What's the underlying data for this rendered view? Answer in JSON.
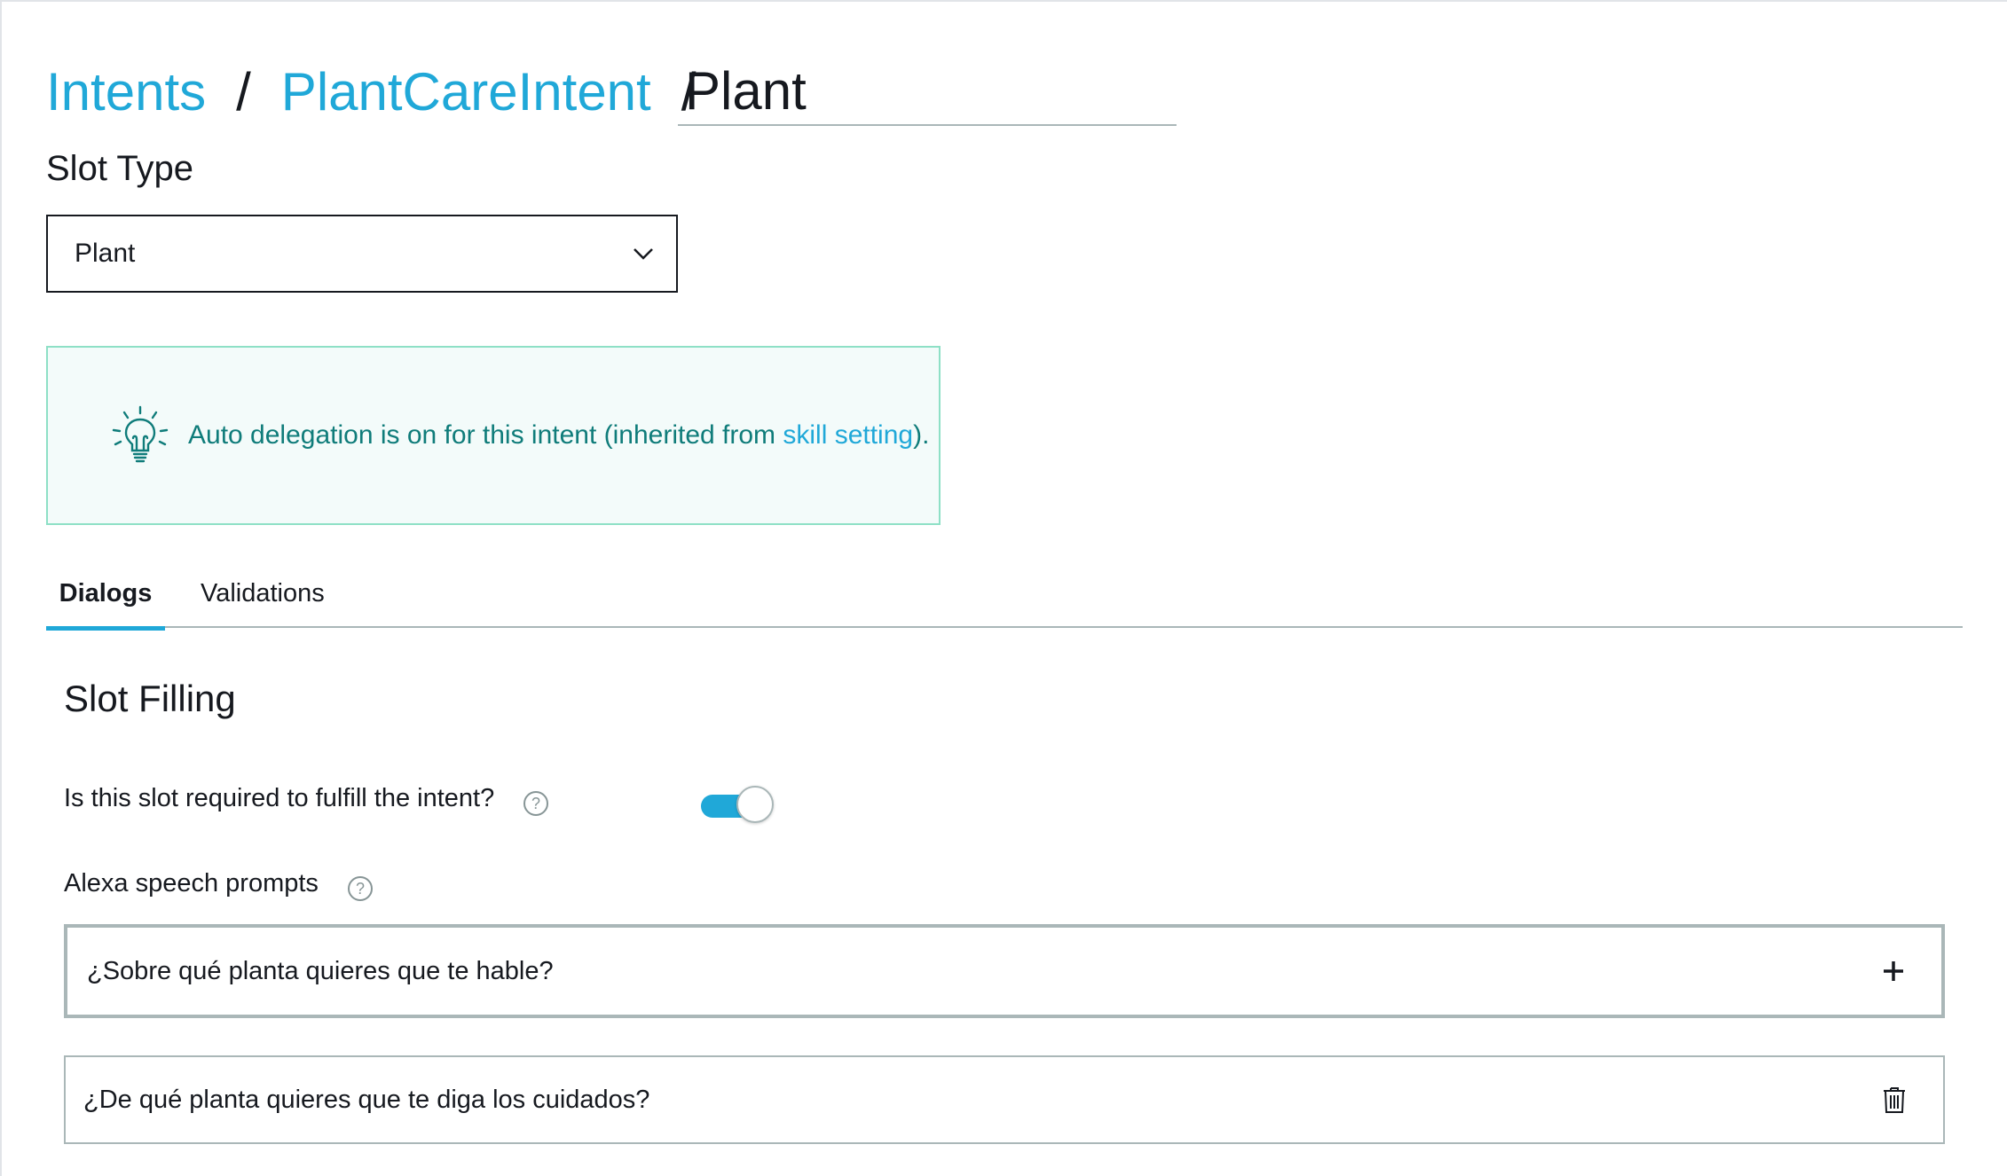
{
  "breadcrumb": {
    "intents_label": "Intents",
    "separator": "/",
    "intent_label": "PlantCareIntent",
    "slot_name": "Plant"
  },
  "slot_type": {
    "label": "Slot Type",
    "selected": "Plant"
  },
  "info": {
    "text_before": "Auto delegation is on for this intent (inherited from ",
    "link_label": "skill setting",
    "text_after": ")."
  },
  "tabs": [
    {
      "label": "Dialogs",
      "active": true
    },
    {
      "label": "Validations",
      "active": false
    }
  ],
  "slot_filling": {
    "title": "Slot Filling",
    "required_question": "Is this slot required to fulfill the intent?",
    "required_enabled": true,
    "help_glyph": "?",
    "prompts_label": "Alexa speech prompts",
    "new_prompt_value": "¿Sobre qué planta quieres que te hable?",
    "prompts": [
      "¿De qué planta quieres que te diga los cuidados?"
    ]
  },
  "colors": {
    "link": "#20a8d8",
    "info_text": "#0f7c7a",
    "info_border": "#8ee0c6",
    "info_bg": "#f3fbfa",
    "toggle_on": "#20a8d8"
  },
  "icons": [
    "lightbulb-icon",
    "chevron-down-icon",
    "help-icon",
    "plus-icon",
    "trash-icon"
  ]
}
